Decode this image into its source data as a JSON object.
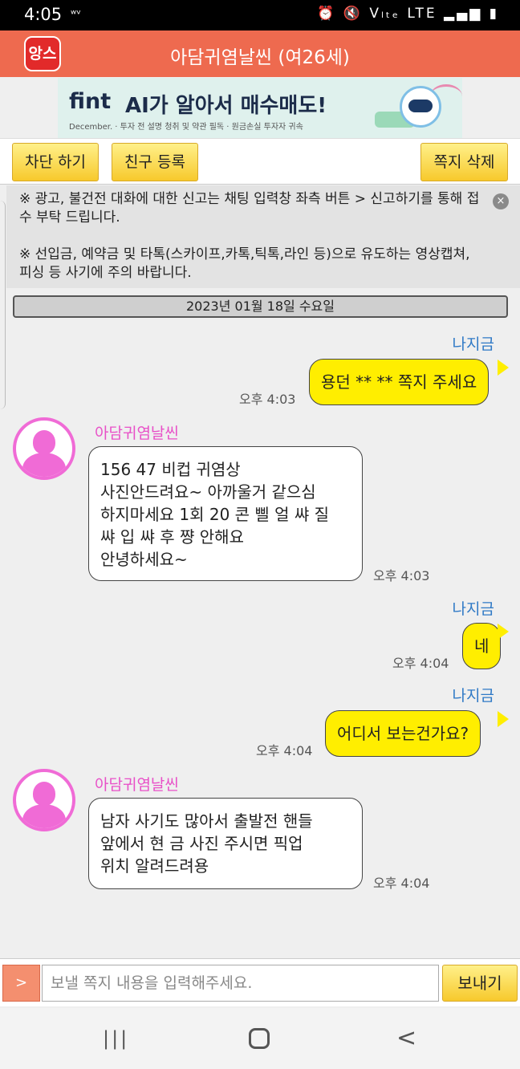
{
  "status_bar": {
    "time": "4:05",
    "left_icon": "ʷᵛ",
    "right_icons": "⏰ 🔇 Vₗₜₑ LTE ▂▄▆ ▮"
  },
  "header": {
    "logo_text": "앙스",
    "title": "아담귀염날씬 (여26세)"
  },
  "ad": {
    "brand": "fint",
    "headline": "AI가 알아서 매수매도!",
    "sub": "December.  ·  투자 전 설명 청취 및 약관 필독  ·  원금손실 투자자 귀속"
  },
  "actions": {
    "block": "차단 하기",
    "friend": "친구 등록",
    "delete": "쪽지 삭제"
  },
  "notice": {
    "line1": "※ 광고, 불건전 대화에 대한 신고는 채팅 입력창 좌측 버튼 > 신고하기를 통해 접수 부탁 드립니다.",
    "line2": "※ 선입금, 예약금 및 타톡(스카이프,카톡,틱톡,라인 등)으로 유도하는 영상캡쳐,피싱 등 사기에 주의 바랍니다.",
    "close": "×"
  },
  "date_label": "2023년 01월 18일 수요일",
  "messages": [
    {
      "from": "me",
      "sender": "나지금",
      "text": "용던 ** ** 쪽지 주세요",
      "time": "오후 4:03"
    },
    {
      "from": "other",
      "sender": "아담귀염날씬",
      "lines": [
        "156 47 비컵 귀염상",
        "사진안드려요~ 아까울거 같으심",
        "하지마세요 1회 20 콘 삘 얼 쌰 질",
        "쌰 입 쌰 후 쨩 안해요",
        "안녕하세요~"
      ],
      "time": "오후 4:03"
    },
    {
      "from": "me",
      "sender": "나지금",
      "text": "네",
      "time": "오후 4:04"
    },
    {
      "from": "me",
      "sender": "나지금",
      "text": "어디서  보는건가요?",
      "time": "오후 4:04"
    },
    {
      "from": "other",
      "sender": "아담귀염날씬",
      "lines": [
        "남자 사기도 많아서 출발전 핸들",
        "앞에서 현     금 사진 주시면 픽업",
        "위치 알려드려용"
      ],
      "time": "오후 4:04"
    }
  ],
  "input": {
    "arrow": ">",
    "placeholder": "보낼 쪽지 내용을 입력해주세요.",
    "send": "보내기"
  },
  "nav": {
    "recent": "|||",
    "back": "<"
  }
}
